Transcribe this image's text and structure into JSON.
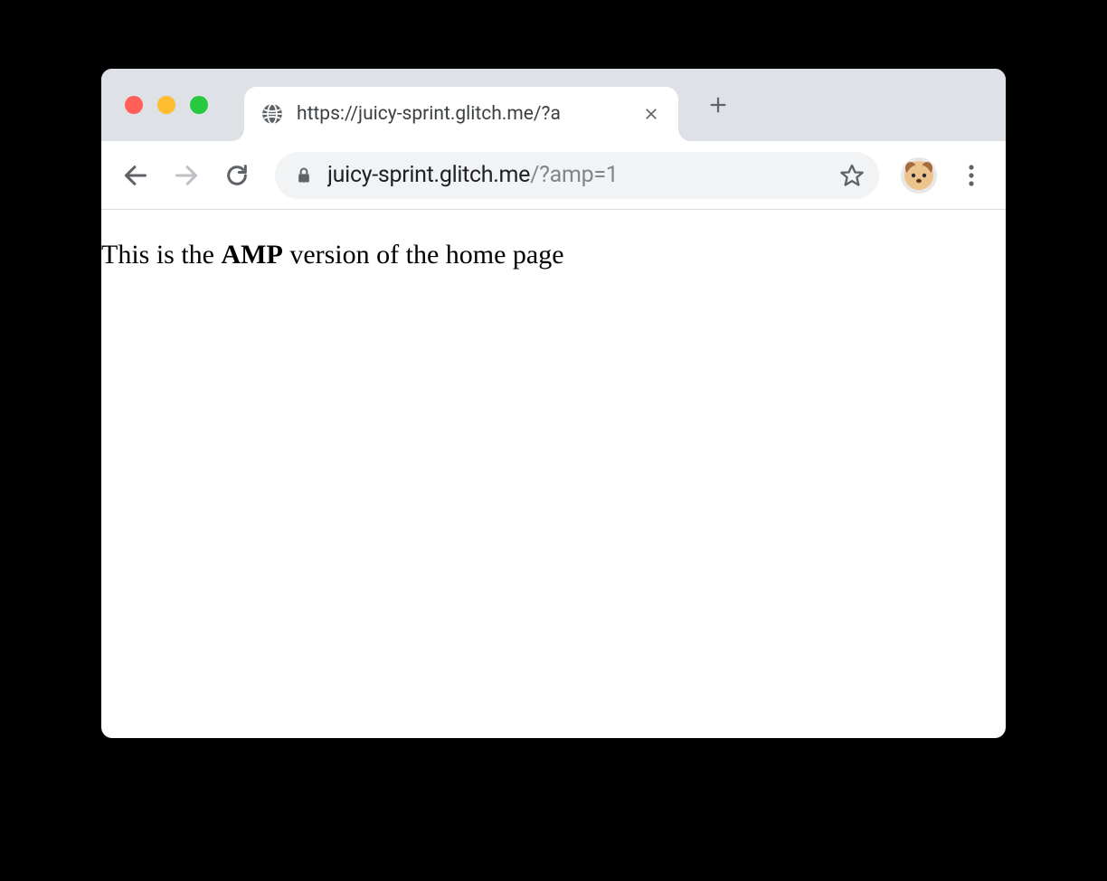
{
  "window": {
    "tab": {
      "title": "https://juicy-sprint.glitch.me/?a",
      "favicon": "globe-icon"
    }
  },
  "toolbar": {
    "url_host": "juicy-sprint.glitch.me",
    "url_query": "/?amp=1"
  },
  "page": {
    "text_before": "This is the ",
    "text_bold": "AMP",
    "text_after": " version of the home page"
  }
}
